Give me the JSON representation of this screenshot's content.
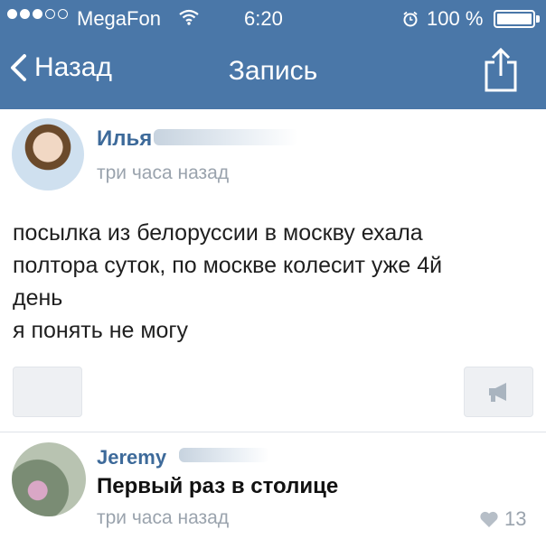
{
  "status_bar": {
    "carrier": "MegaFon",
    "time": "6:20",
    "battery": "100 %",
    "signal_icon": "signal-dots-icon",
    "wifi_icon": "wifi-icon",
    "alarm_icon": "alarm-clock-icon"
  },
  "nav": {
    "back_label": "Назад",
    "title": "Запись",
    "share_icon": "share-icon"
  },
  "post": {
    "author": "Илья",
    "time": "три часа назад",
    "text_lines": [
      "посылка из белоруссии в москву ехала",
      "полтора суток, по москве колесит уже 4й",
      "день",
      "я понять не могу"
    ]
  },
  "comment": {
    "author": "Jeremy",
    "text": "Первый раз в столице",
    "time": "три часа назад",
    "likes": "13"
  },
  "colors": {
    "nav_background": "#4a77a8",
    "name_link": "#3d6a9a",
    "meta_gray": "#9aa3ad"
  }
}
